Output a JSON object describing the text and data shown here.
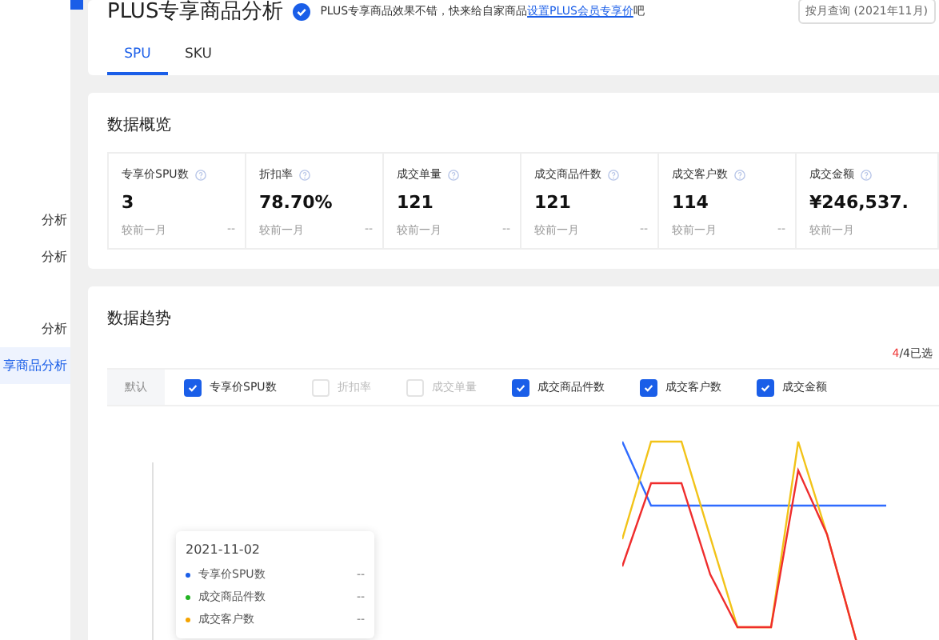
{
  "sidebar": {
    "items": [
      {
        "label": "分析",
        "selected": false
      },
      {
        "label": "分析",
        "selected": false
      },
      {
        "label": "分析",
        "selected": false
      },
      {
        "label": "享商品分析",
        "selected": true
      }
    ]
  },
  "header": {
    "title": "PLUS专享商品分析",
    "notice": "PLUS专享商品效果不错，快来给自家商品",
    "notice_link": "设置PLUS会员专享价",
    "notice_end": "吧",
    "period_select": "按月查询 (2021年11月)",
    "tabs": [
      {
        "label": "SPU",
        "selected": true
      },
      {
        "label": "SKU",
        "selected": false
      }
    ]
  },
  "overview": {
    "title": "数据概览",
    "metrics": [
      {
        "label": "专享价SPU数",
        "value": "3",
        "compare": "较前一月",
        "change": "--"
      },
      {
        "label": "折扣率",
        "value": "78.70%",
        "compare": "较前一月",
        "change": "--"
      },
      {
        "label": "成交单量",
        "value": "121",
        "compare": "较前一月",
        "change": "--"
      },
      {
        "label": "成交商品件数",
        "value": "121",
        "compare": "较前一月",
        "change": "--"
      },
      {
        "label": "成交客户数",
        "value": "114",
        "compare": "较前一月",
        "change": "--"
      },
      {
        "label": "成交金额",
        "value": "¥246,537.",
        "compare": "较前一月"
      }
    ]
  },
  "trend": {
    "title": "数据趋势",
    "selected_count": "4",
    "selected_total": "/4已选",
    "default_tag": "默认",
    "options": [
      {
        "label": "专享价SPU数",
        "checked": true
      },
      {
        "label": "折扣率",
        "checked": false
      },
      {
        "label": "成交单量",
        "checked": false
      },
      {
        "label": "成交商品件数",
        "checked": true
      },
      {
        "label": "成交客户数",
        "checked": true
      },
      {
        "label": "成交金额",
        "checked": true
      }
    ],
    "tooltip": {
      "date": "2021-11-02",
      "items": [
        {
          "label": "专享价SPU数",
          "value": "--",
          "color": "#1a5ee8"
        },
        {
          "label": "成交商品件数",
          "value": "--",
          "color": "#22b322"
        },
        {
          "label": "成交客户数",
          "value": "--",
          "color": "#f5a300"
        }
      ]
    }
  }
}
